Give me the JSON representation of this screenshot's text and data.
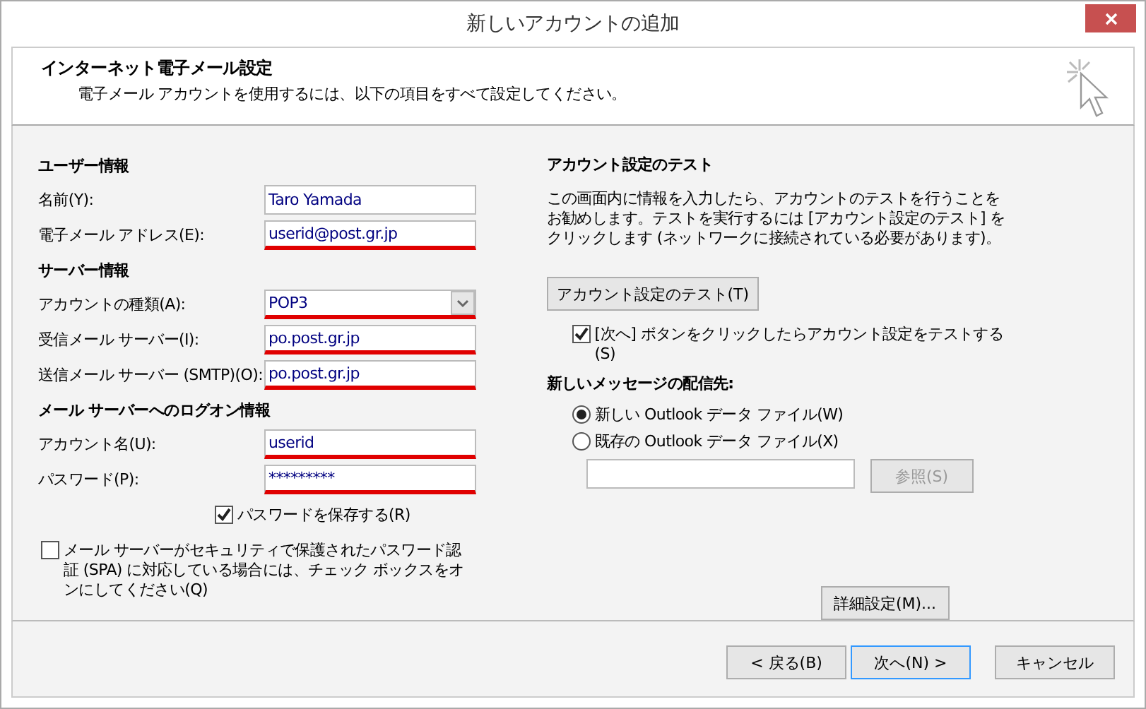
{
  "window": {
    "title": "新しいアカウントの追加"
  },
  "header": {
    "title": "インターネット電子メール設定",
    "subtitle": "電子メール アカウントを使用するには、以下の項目をすべて設定してください。"
  },
  "left": {
    "sections": [
      {
        "heading": "ユーザー情報",
        "fields": [
          {
            "kind": "text",
            "label": "名前(Y):",
            "value": "Taro Yamada",
            "underlined": false
          },
          {
            "kind": "text",
            "label": "電子メール アドレス(E):",
            "value": "userid@post.gr.jp",
            "underlined": true
          }
        ]
      },
      {
        "heading": "サーバー情報",
        "fields": [
          {
            "kind": "select",
            "label": "アカウントの種類(A):",
            "value": "POP3",
            "underlined": true
          },
          {
            "kind": "text",
            "label": "受信メール サーバー(I):",
            "value": "po.post.gr.jp",
            "underlined": true
          },
          {
            "kind": "text",
            "label": "送信メール サーバー (SMTP)(O):",
            "value": "po.post.gr.jp",
            "underlined": true
          }
        ]
      },
      {
        "heading": "メール サーバーへのログオン情報",
        "fields": [
          {
            "kind": "text",
            "label": "アカウント名(U):",
            "value": "userid",
            "underlined": true
          },
          {
            "kind": "text",
            "label": "パスワード(P):",
            "value": "*********",
            "underlined": true
          }
        ]
      }
    ],
    "save_password": {
      "label": "パスワードを保存する(R)",
      "checked": true
    },
    "spa": {
      "label": "メール サーバーがセキュリティで保護されたパスワード認証 (SPA) に対応している場合には、チェック ボックスをオンにしてください(Q)",
      "checked": false
    }
  },
  "right": {
    "heading": "アカウント設定のテスト",
    "description": "この画面内に情報を入力したら、アカウントのテストを行うことをお勧めします。テストを実行するには [アカウント設定のテスト] をクリックします (ネットワークに接続されている必要があります)。",
    "test_button": "アカウント設定のテスト(T)",
    "test_on_next": {
      "label": "[次へ] ボタンをクリックしたらアカウント設定をテストする(S)",
      "checked": true
    },
    "delivery_heading": "新しいメッセージの配信先:",
    "delivery_options": [
      {
        "label": "新しい Outlook データ ファイル(W)",
        "selected": true
      },
      {
        "label": "既存の Outlook データ ファイル(X)",
        "selected": false
      }
    ],
    "browse_button": {
      "label": "参照(S)",
      "disabled": true
    },
    "more_settings_button": "詳細設定(M)..."
  },
  "buttons": [
    {
      "label": "< 戻る(B)",
      "focused": false
    },
    {
      "label": "次へ(N) >",
      "focused": true
    },
    {
      "label": "キャンセル",
      "focused": false
    }
  ]
}
